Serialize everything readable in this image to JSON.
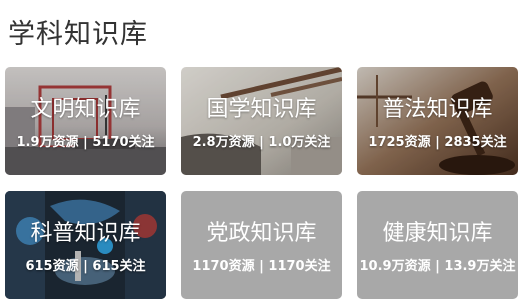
{
  "page": {
    "title": "学科知识库"
  },
  "cards": [
    {
      "title": "文明知识库",
      "resources": "1.9万资源",
      "sep": "|",
      "follows": "5170关注"
    },
    {
      "title": "国学知识库",
      "resources": "2.8万资源",
      "sep": "|",
      "follows": "1.0万关注"
    },
    {
      "title": "普法知识库",
      "resources": "1725资源",
      "sep": "|",
      "follows": "2835关注"
    },
    {
      "title": "科普知识库",
      "resources": "615资源",
      "sep": "|",
      "follows": "615关注"
    },
    {
      "title": "党政知识库",
      "resources": "1170资源",
      "sep": "|",
      "follows": "1170关注"
    },
    {
      "title": "健康知识库",
      "resources": "10.9万资源",
      "sep": "|",
      "follows": "13.9万关注"
    }
  ]
}
